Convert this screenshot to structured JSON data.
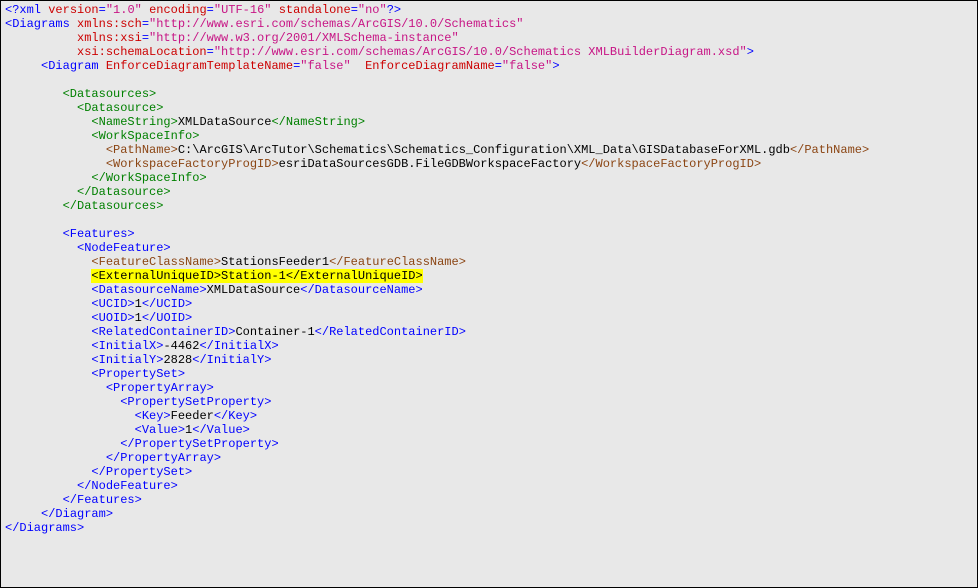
{
  "xml": {
    "decl_open": "<?xml",
    "attr_version_name": "version",
    "attr_version_val": "\"1.0\"",
    "attr_encoding_name": "encoding",
    "attr_encoding_val": "\"UTF-16\"",
    "attr_standalone_name": "standalone",
    "attr_standalone_val": "\"no\"",
    "decl_close": "?>",
    "diagrams_open": "<Diagrams",
    "ns_sch_name": "xmlns:sch",
    "ns_sch_val": "\"http://www.esri.com/schemas/ArcGIS/10.0/Schematics\"",
    "ns_xsi_name": "xmlns:xsi",
    "ns_xsi_val": "\"http://www.w3.org/2001/XMLSchema-instance\"",
    "ns_loc_name": "xsi:schemaLocation",
    "ns_loc_val": "\"http://www.esri.com/schemas/ArcGIS/10.0/Schematics XMLBuilderDiagram.xsd\"",
    "diagram_open": "<Diagram",
    "attr_tmpl_name": "EnforceDiagramTemplateName",
    "attr_tmpl_val": "\"false\"",
    "attr_dname_name": "EnforceDiagramName",
    "attr_dname_val": "\"false\"",
    "datasources_open": "<Datasources>",
    "datasource_open": "<Datasource>",
    "namestring_open": "<NameString>",
    "namestring_val": "XMLDataSource",
    "namestring_close": "</NameString>",
    "workspaceinfo_open": "<WorkSpaceInfo>",
    "pathname_open": "<PathName>",
    "pathname_val": "C:\\ArcGIS\\ArcTutor\\Schematics\\Schematics_Configuration\\XML_Data\\GISDatabaseForXML.gdb",
    "pathname_close": "</PathName>",
    "wfpid_open": "<WorkspaceFactoryProgID>",
    "wfpid_val": "esriDataSourcesGDB.FileGDBWorkspaceFactory",
    "wfpid_close": "</WorkspaceFactoryProgID>",
    "workspaceinfo_close": "</WorkSpaceInfo>",
    "datasource_close": "</Datasource>",
    "datasources_close": "</Datasources>",
    "features_open": "<Features>",
    "nodefeature_open": "<NodeFeature>",
    "fcn_open": "<FeatureClassName>",
    "fcn_val": "StationsFeeder1",
    "fcn_close": "</FeatureClassName>",
    "euid_open": "<ExternalUniqueID>",
    "euid_val": "Station-1",
    "euid_close": "</ExternalUniqueID>",
    "dsn_open": "<DatasourceName>",
    "dsn_val": "XMLDataSource",
    "dsn_close": "</DatasourceName>",
    "ucid_open": "<UCID>",
    "ucid_val": "1",
    "ucid_close": "</UCID>",
    "uoid_open": "<UOID>",
    "uoid_val": "1",
    "uoid_close": "</UOID>",
    "rcid_open": "<RelatedContainerID>",
    "rcid_val": "Container-1",
    "rcid_close": "</RelatedContainerID>",
    "ix_open": "<InitialX>",
    "ix_val": "-4462",
    "ix_close": "</InitialX>",
    "iy_open": "<InitialY>",
    "iy_val": "2828",
    "iy_close": "</InitialY>",
    "ps_open": "<PropertySet>",
    "pa_open": "<PropertyArray>",
    "psp_open": "<PropertySetProperty>",
    "key_open": "<Key>",
    "key_val": "Feeder",
    "key_close": "</Key>",
    "val_open": "<Value>",
    "val_val": "1",
    "val_close": "</Value>",
    "psp_close": "</PropertySetProperty>",
    "pa_close": "</PropertyArray>",
    "ps_close": "</PropertySet>",
    "nodefeature_close": "</NodeFeature>",
    "features_close": "</Features>",
    "diagram_close": "</Diagram>",
    "diagrams_close": "</Diagrams>"
  }
}
